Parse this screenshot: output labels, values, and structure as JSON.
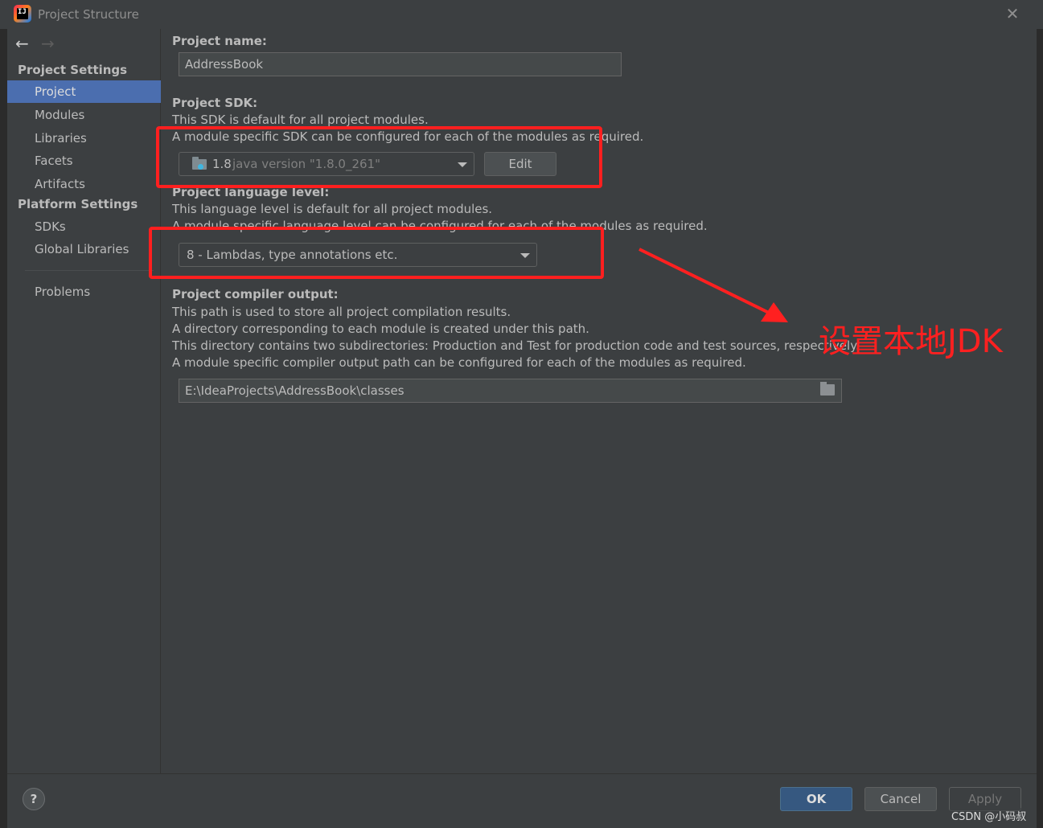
{
  "window": {
    "title": "Project Structure",
    "app_icon_text": "IJ"
  },
  "sidebar": {
    "sections": [
      {
        "header": "Project Settings",
        "items": [
          "Project",
          "Modules",
          "Libraries",
          "Facets",
          "Artifacts"
        ]
      },
      {
        "header": "Platform Settings",
        "items": [
          "SDKs",
          "Global Libraries"
        ]
      }
    ],
    "problems": "Problems",
    "selected": "Project"
  },
  "project_name": {
    "label": "Project name:",
    "value": "AddressBook"
  },
  "project_sdk": {
    "label": "Project SDK:",
    "desc1": "This SDK is default for all project modules.",
    "desc2": "A module specific SDK can be configured for each of the modules as required.",
    "sdk_version": "1.8",
    "sdk_detail": "java version \"1.8.0_261\"",
    "edit_label": "Edit"
  },
  "language_level": {
    "label": "Project language level:",
    "desc1": "This language level is default for all project modules.",
    "desc2": "A module specific language level can be configured for each of the modules as required.",
    "value": "8 - Lambdas, type annotations etc."
  },
  "compiler_output": {
    "label": "Project compiler output:",
    "desc1": "This path is used to store all project compilation results.",
    "desc2": "A directory corresponding to each module is created under this path.",
    "desc3": "This directory contains two subdirectories: Production and Test for production code and test sources, respectively.",
    "desc4": "A module specific compiler output path can be configured for each of the modules as required.",
    "path": "E:\\IdeaProjects\\AddressBook\\classes"
  },
  "footer": {
    "help": "?",
    "ok": "OK",
    "cancel": "Cancel",
    "apply": "Apply",
    "watermark": "CSDN @小码叔"
  },
  "annotation": {
    "text": "设置本地JDK",
    "color": "#ff2020"
  },
  "colors": {
    "selection": "#4b6eaf",
    "background": "#3c3f41",
    "ok_button": "#365880",
    "highlight_box": "#ff1f1f"
  }
}
